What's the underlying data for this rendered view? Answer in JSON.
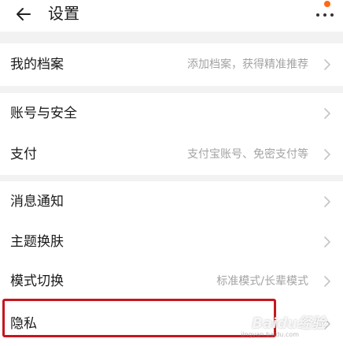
{
  "header": {
    "title": "设置",
    "back_icon": "arrow-left-icon",
    "more_icon": "more-horizontal-icon"
  },
  "colors": {
    "notify_dot": "#ff6a13",
    "highlight": "#c6161f"
  },
  "groups": [
    {
      "rows": [
        {
          "label": "我的档案",
          "value": "添加档案，获得精准推荐"
        }
      ]
    },
    {
      "rows": [
        {
          "label": "账号与安全",
          "value": ""
        },
        {
          "label": "支付",
          "value": "支付宝账号、免密支付等"
        }
      ]
    },
    {
      "rows": [
        {
          "label": "消息通知",
          "value": ""
        },
        {
          "label": "主题换肤",
          "value": ""
        },
        {
          "label": "模式切换",
          "value": "标准模式/长辈模式"
        },
        {
          "label": "隐私",
          "value": ""
        }
      ]
    }
  ],
  "watermark": {
    "text": "Baidu经验",
    "sub": "jingyan.baidu.com"
  }
}
